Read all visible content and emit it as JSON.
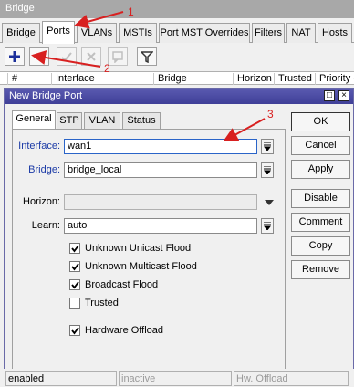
{
  "window": {
    "title": "Bridge"
  },
  "tabs": [
    {
      "label": "Bridge"
    },
    {
      "label": "Ports"
    },
    {
      "label": "VLANs"
    },
    {
      "label": "MSTIs"
    },
    {
      "label": "Port MST Overrides"
    },
    {
      "label": "Filters"
    },
    {
      "label": "NAT"
    },
    {
      "label": "Hosts"
    }
  ],
  "toolbar": {
    "icons": [
      "add-icon",
      "remove-icon",
      "enable-icon",
      "disable-icon",
      "comment-icon",
      "filter-icon"
    ]
  },
  "table": {
    "columns": [
      "#",
      "Interface",
      "Bridge",
      "Horizon",
      "Trusted",
      "Priority (h"
    ]
  },
  "dialog": {
    "title": "New Bridge Port",
    "controls": {
      "maximize": "□",
      "close": "×"
    },
    "tabs": [
      {
        "label": "General"
      },
      {
        "label": "STP"
      },
      {
        "label": "VLAN"
      },
      {
        "label": "Status"
      }
    ],
    "fields": {
      "interface": {
        "label": "Interface:",
        "value": "wan1"
      },
      "bridge": {
        "label": "Bridge:",
        "value": "bridge_local"
      },
      "horizon": {
        "label": "Horizon:",
        "value": ""
      },
      "learn": {
        "label": "Learn:",
        "value": "auto"
      }
    },
    "checkboxes": [
      {
        "label": "Unknown Unicast Flood",
        "checked": true
      },
      {
        "label": "Unknown Multicast Flood",
        "checked": true
      },
      {
        "label": "Broadcast Flood",
        "checked": true
      },
      {
        "label": "Trusted",
        "checked": false
      },
      {
        "label": "Hardware Offload",
        "checked": true
      }
    ],
    "buttons": {
      "ok": "OK",
      "cancel": "Cancel",
      "apply": "Apply",
      "disable": "Disable",
      "comment": "Comment",
      "copy": "Copy",
      "remove": "Remove"
    }
  },
  "status_bar": {
    "status": "enabled",
    "state": "inactive",
    "hw": "Hw. Offload"
  },
  "annotations": {
    "one": "1",
    "two": "2",
    "three": "3",
    "color": "#d82020"
  }
}
